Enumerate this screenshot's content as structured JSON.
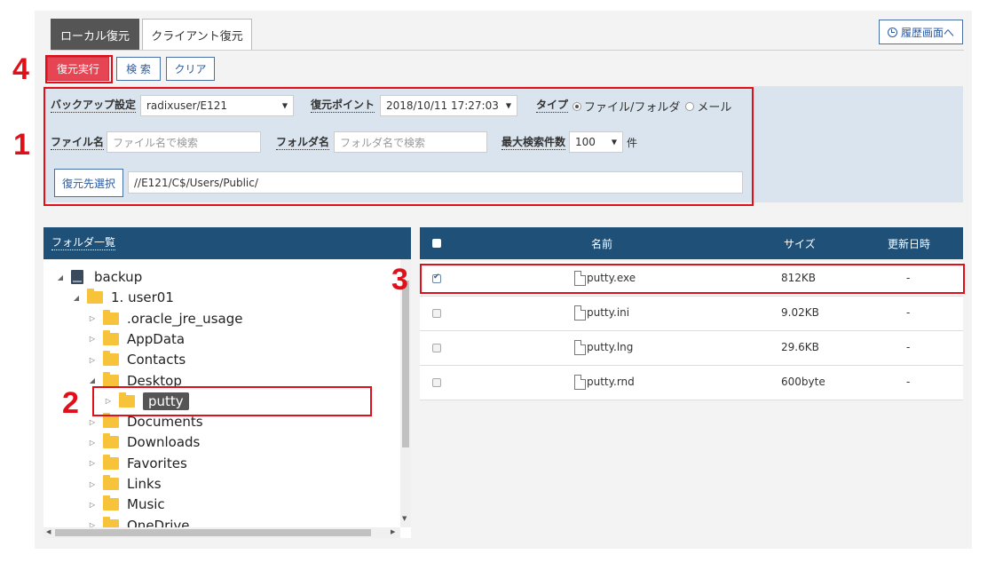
{
  "tabs": [
    "ローカル復元",
    "クライアント復元"
  ],
  "history_button": "履歴画面へ",
  "toolbar": {
    "restore": "復元実行",
    "search": "検 索",
    "clear": "クリア"
  },
  "form": {
    "backup_label": "バックアップ設定",
    "backup_value": "radixuser/E121",
    "restore_point_label": "復元ポイント",
    "restore_point_value": "2018/10/11 17:27:03",
    "type_label": "タイプ",
    "type_file": "ファイル/フォルダ",
    "type_mail": "メール",
    "filename_label": "ファイル名",
    "filename_placeholder": "ファイル名で検索",
    "foldername_label": "フォルダ名",
    "foldername_placeholder": "フォルダ名で検索",
    "max_label": "最大検索件数",
    "max_value": "100",
    "max_unit": "件",
    "dest_button": "復元先選択",
    "dest_path": "//E121/C$/Users/Public/"
  },
  "folder_panel": {
    "title": "フォルダ一覧",
    "tree": [
      {
        "label": "backup",
        "depth": 0,
        "icon": "server",
        "toggle": "expanded"
      },
      {
        "label": "1. user01",
        "depth": 1,
        "icon": "folder",
        "toggle": "expanded"
      },
      {
        "label": ".oracle_jre_usage",
        "depth": 2,
        "icon": "folder",
        "toggle": "collapsed"
      },
      {
        "label": "AppData",
        "depth": 2,
        "icon": "folder",
        "toggle": "collapsed"
      },
      {
        "label": "Contacts",
        "depth": 2,
        "icon": "folder",
        "toggle": "collapsed"
      },
      {
        "label": "Desktop",
        "depth": 2,
        "icon": "folder",
        "toggle": "expanded"
      },
      {
        "label": "putty",
        "depth": 3,
        "icon": "folder",
        "toggle": "collapsed",
        "selected": true
      },
      {
        "label": "Documents",
        "depth": 2,
        "icon": "folder",
        "toggle": "collapsed"
      },
      {
        "label": "Downloads",
        "depth": 2,
        "icon": "folder",
        "toggle": "collapsed"
      },
      {
        "label": "Favorites",
        "depth": 2,
        "icon": "folder",
        "toggle": "collapsed"
      },
      {
        "label": "Links",
        "depth": 2,
        "icon": "folder",
        "toggle": "collapsed"
      },
      {
        "label": "Music",
        "depth": 2,
        "icon": "folder",
        "toggle": "collapsed"
      },
      {
        "label": "OneDrive",
        "depth": 2,
        "icon": "folder",
        "toggle": "collapsed"
      }
    ]
  },
  "file_table": {
    "columns": [
      "名前",
      "サイズ",
      "更新日時"
    ],
    "rows": [
      {
        "name": "putty.exe",
        "size": "812KB",
        "date": "-",
        "checked": true
      },
      {
        "name": "putty.ini",
        "size": "9.02KB",
        "date": "-",
        "checked": false
      },
      {
        "name": "putty.lng",
        "size": "29.6KB",
        "date": "-",
        "checked": false
      },
      {
        "name": "putty.rnd",
        "size": "600byte",
        "date": "-",
        "checked": false
      }
    ]
  },
  "annotations": [
    "1",
    "2",
    "3",
    "4"
  ],
  "colors": {
    "header_bg": "#1f5078",
    "panel_bg": "#d9e4ee",
    "restore_btn": "#e64553",
    "annotation": "#e0101a"
  }
}
